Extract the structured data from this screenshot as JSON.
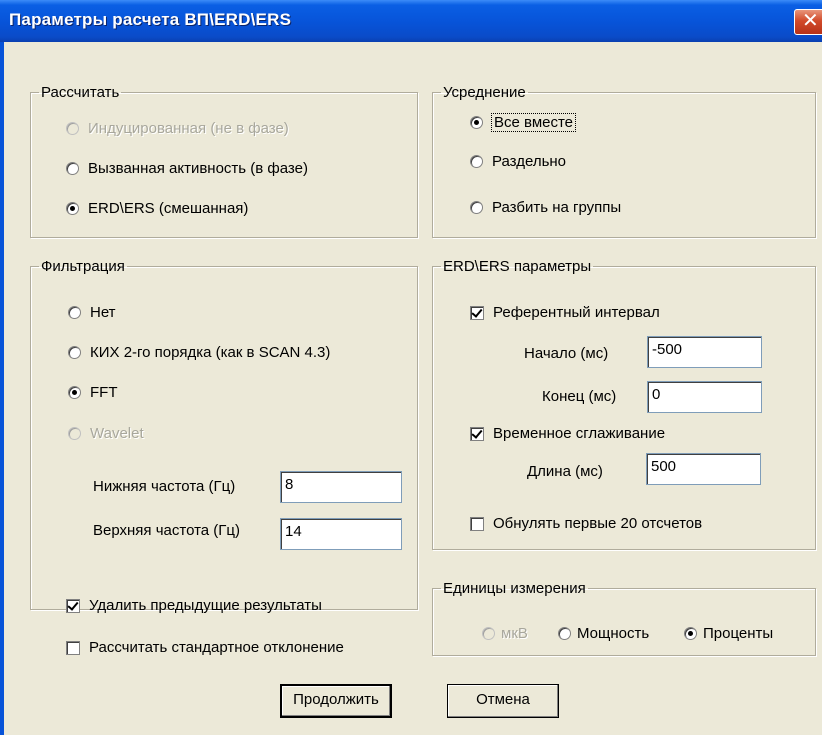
{
  "window": {
    "title": "Параметры расчета ВП\\ERD\\ERS",
    "close_glyph": "✕"
  },
  "calculate": {
    "legend": "Рассчитать",
    "options": [
      {
        "label": "Индуцированная (не в фазе)",
        "checked": false,
        "disabled": true
      },
      {
        "label": "Вызванная активность (в фазе)",
        "checked": false,
        "disabled": false
      },
      {
        "label": "ERD\\ERS (смешанная)",
        "checked": true,
        "disabled": false
      }
    ]
  },
  "averaging": {
    "legend": "Усреднение",
    "options": [
      {
        "label": "Все вместе",
        "checked": true,
        "disabled": false
      },
      {
        "label": "Раздельно",
        "checked": false,
        "disabled": false
      },
      {
        "label": "Разбить на группы",
        "checked": false,
        "disabled": false
      }
    ]
  },
  "filtering": {
    "legend": "Фильтрация",
    "options": [
      {
        "label": "Нет",
        "checked": false,
        "disabled": false
      },
      {
        "label": "КИХ 2-го порядка (как в SCAN 4.3)",
        "checked": false,
        "disabled": false
      },
      {
        "label": "FFT",
        "checked": true,
        "disabled": false
      },
      {
        "label": "Wavelet",
        "checked": false,
        "disabled": true
      }
    ],
    "low_freq": {
      "label": "Нижняя частота (Гц)",
      "value": "8"
    },
    "high_freq": {
      "label": "Верхняя частота (Гц)",
      "value": "14"
    }
  },
  "erd_params": {
    "legend": "ERD\\ERS параметры",
    "reference_interval": {
      "label": "Референтный интервал",
      "checked": true
    },
    "start": {
      "label": "Начало (мс)",
      "value": "-500"
    },
    "end": {
      "label": "Конец (мс)",
      "value": "0"
    },
    "temporal_smoothing": {
      "label": "Временное сглаживание",
      "checked": true
    },
    "length": {
      "label": "Длина (мс)",
      "value": "500"
    },
    "zero_first": {
      "label": "Обнулять первые 20 отсчетов",
      "checked": false
    }
  },
  "options": {
    "delete_previous": {
      "label": "Удалить предыдущие результаты",
      "checked": true
    },
    "compute_std": {
      "label": "Рассчитать стандартное отклонение",
      "checked": false
    }
  },
  "units": {
    "legend": "Единицы измерения",
    "options": [
      {
        "label": "мкВ",
        "checked": false,
        "disabled": true
      },
      {
        "label": "Мощность",
        "checked": false,
        "disabled": false
      },
      {
        "label": "Проценты",
        "checked": true,
        "disabled": false
      }
    ]
  },
  "buttons": {
    "continue": "Продолжить",
    "cancel": "Отмена"
  },
  "colors": {
    "titlebar": "#0753D8",
    "dialog_bg": "#ECE9D8",
    "close_button": "#D14A2A",
    "disabled_text": "#A8A79C"
  }
}
